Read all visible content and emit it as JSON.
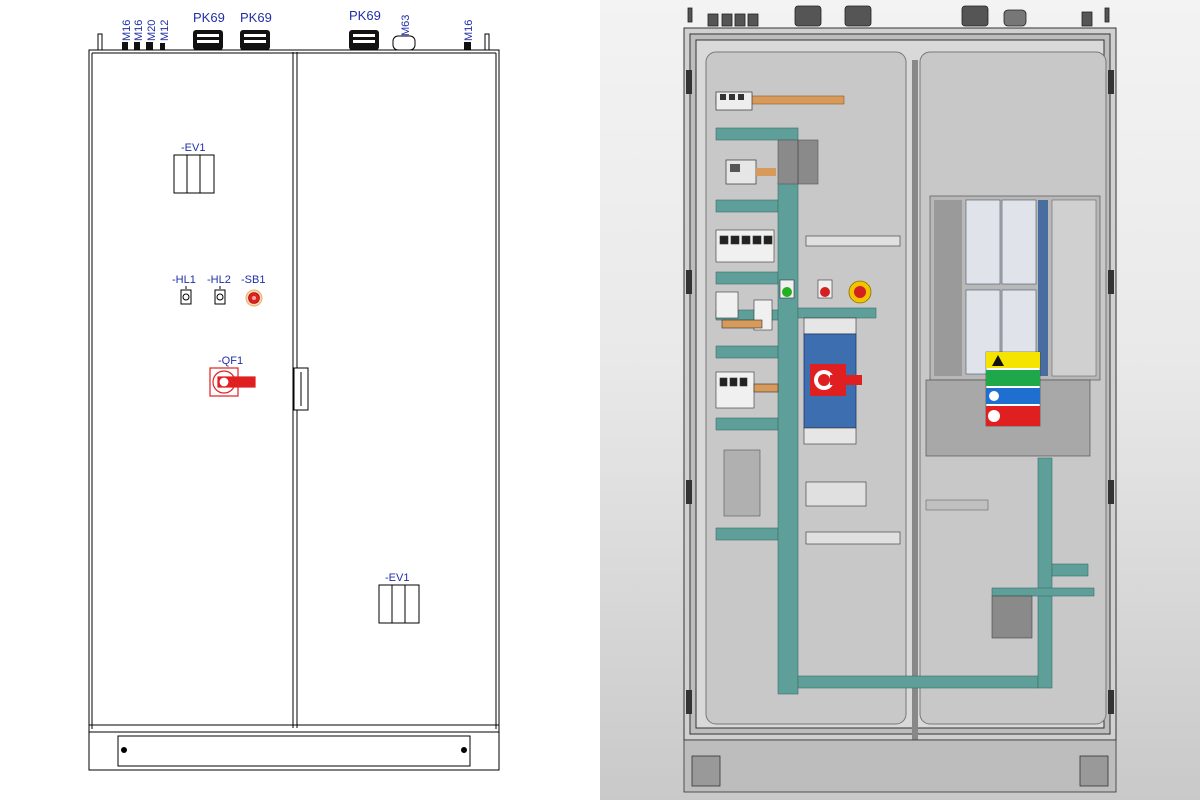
{
  "front_view": {
    "gland_labels": {
      "m16_a": "M16",
      "m16_b": "M16",
      "m20": "M20",
      "m12": "M12",
      "pk69_a": "PK69",
      "pk69_b": "PK69",
      "pk69_c": "PK69",
      "m63": "M63",
      "m16_c": "M16"
    },
    "device_labels": {
      "ev1_top": "-EV1",
      "hl1": "-HL1",
      "hl2": "-HL2",
      "sb1": "-SB1",
      "qf1": "-QF1",
      "ev1_bottom": "-EV1"
    },
    "colors": {
      "label_blue": "#1f2fa8",
      "switch_red": "#e02020",
      "outline": "#000000"
    }
  },
  "interior_view": {
    "colors": {
      "background": "#e8e8e8",
      "wire_duct": "#5f9f9a",
      "din_rail": "#d89a5a",
      "mounting_plate": "#c4c4c4",
      "green_lamp": "#22b022",
      "red_lamp": "#d42020",
      "estop_yellow": "#f2c400",
      "switch_blue": "#3d6fb0",
      "switch_red": "#e02020",
      "warning_yellow": "#f4e400",
      "safety_green": "#1ea84a",
      "info_blue": "#1e6fd0",
      "danger_red": "#e02020"
    }
  }
}
